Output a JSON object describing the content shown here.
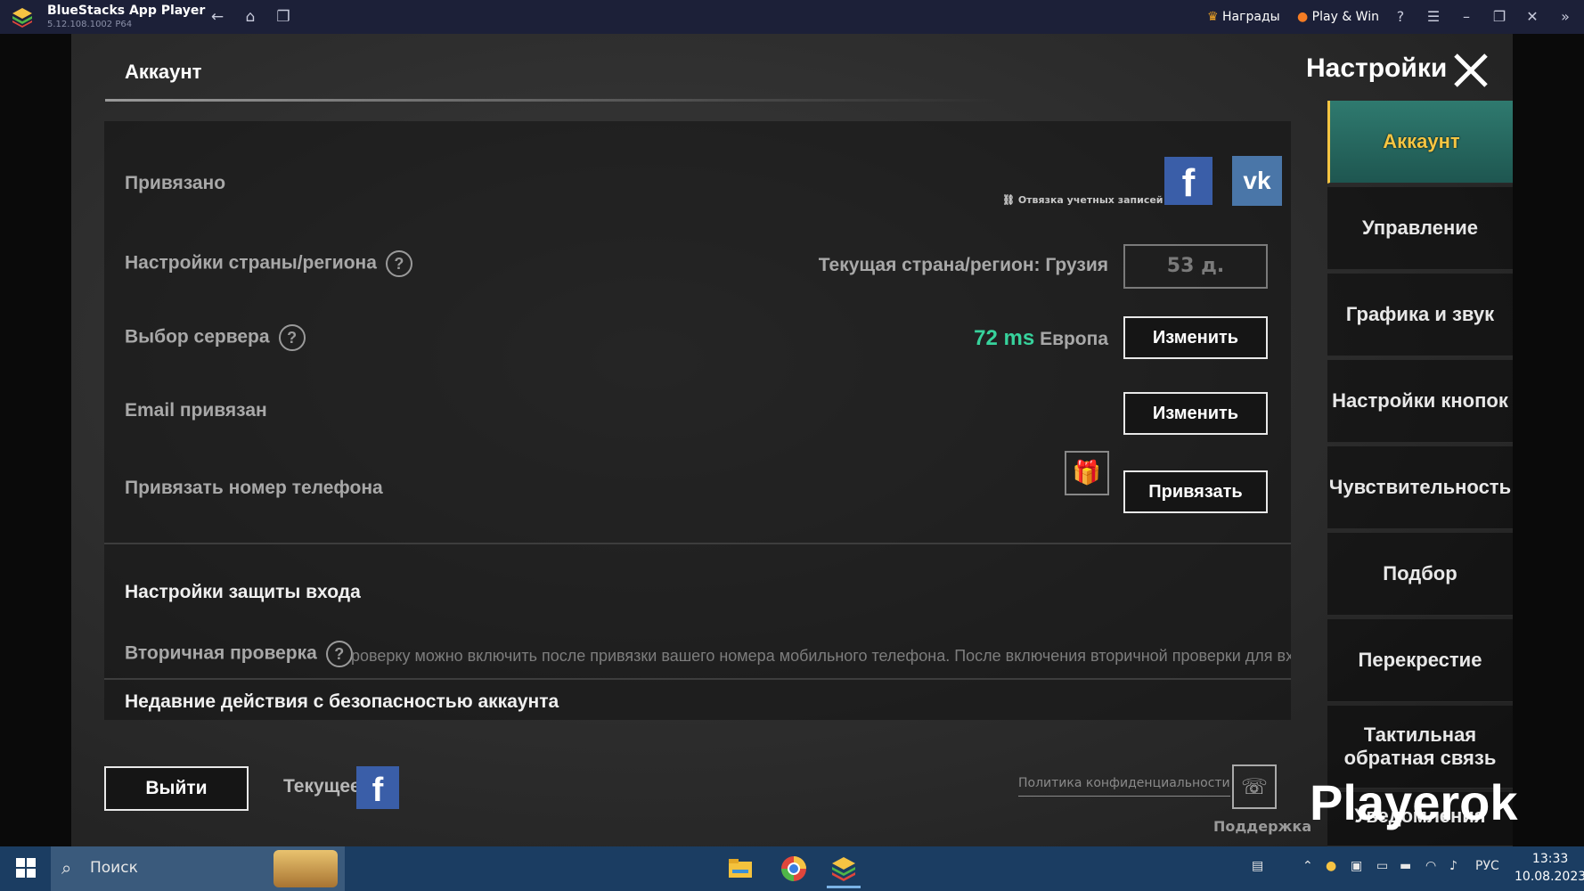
{
  "titlebar": {
    "app_name": "BlueStacks App Player",
    "version": "5.12.108.1002  P64",
    "rewards_label": "Награды",
    "playwin_label": "Play & Win"
  },
  "header": {
    "tab_title": "Аккаунт",
    "settings_title": "Настройки"
  },
  "account": {
    "linked_label": "Привязано",
    "unlink_label": "Отвязка учетных записей",
    "region_label": "Настройки страны/региона",
    "region_current": "Текущая страна/регион: Грузия",
    "region_days": "53 д.",
    "server_label": "Выбор сервера",
    "server_ping": "72 ms",
    "server_region": "Европа",
    "change_label": "Изменить",
    "email_label": "Email привязан",
    "phone_label": "Привязать номер телефона",
    "bind_label": "Привязать",
    "security_title": "Настройки защиты входа",
    "secondary_label": "Вторичная проверка",
    "secondary_desc": "роверку можно включить после привязки вашего номера мобильного телефона. После включения вторичной проверки для входа в игру",
    "recent_title": "Недавние действия с безопасностью аккаунта"
  },
  "sidebar": {
    "items": [
      {
        "label": "Аккаунт",
        "active": true
      },
      {
        "label": "Управление"
      },
      {
        "label": "Графика и звук"
      },
      {
        "label": "Настройки кнопок"
      },
      {
        "label": "Чувствительность"
      },
      {
        "label": "Подбор"
      },
      {
        "label": "Перекрестие"
      },
      {
        "label": "Тактильная обратная связь"
      },
      {
        "label": "Уведомления"
      }
    ]
  },
  "footer": {
    "exit_label": "Выйти",
    "current_label": "Текущее",
    "privacy_label": "Политика конфиденциальности",
    "support_label": "Поддержка"
  },
  "watermark": "Playerok",
  "taskbar": {
    "search_placeholder": "Поиск",
    "lang": "РУС",
    "time": "13:33",
    "date": "10.08.2023"
  },
  "colors": {
    "accent_gold": "#f5c542",
    "ping_green": "#37d29c",
    "facebook_blue": "#3a5ea8",
    "vk_blue": "#4a76a8"
  }
}
